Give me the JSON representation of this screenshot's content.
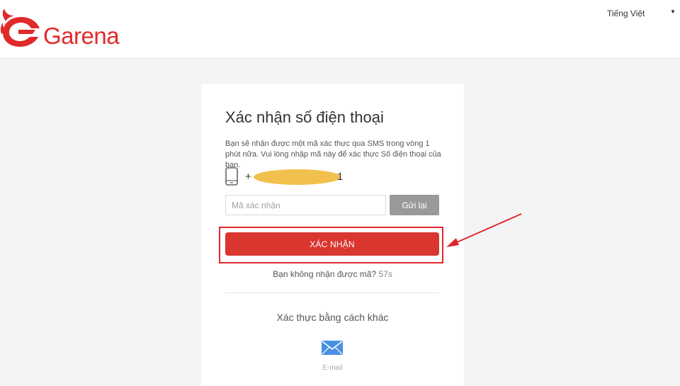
{
  "header": {
    "brand": "Garena",
    "language": "Tiếng Việt",
    "brand_color": "#e02a2a"
  },
  "card": {
    "title": "Xác nhận số điện thoại",
    "description": "Bạn sẽ nhận được một mã xác thực qua SMS trong vòng 1 phút nữa. Vui lòng nhập mã này để xác thực Số điện thoại của bạn.",
    "phone_prefix": "+",
    "phone_suffix": "1",
    "code_placeholder": "Mã xác nhận",
    "resend_label": "Gửi lại",
    "confirm_label": "XÁC NHẬN",
    "no_code_text": "Bạn không nhận được mã?",
    "timer": "57s",
    "alt_title": "Xác thực bằng cách khác",
    "email_label": "E-mail"
  },
  "colors": {
    "confirm_button": "#d9362f",
    "highlight": "#e0262b",
    "resend_button": "#999999",
    "email_icon": "#4a90e2"
  },
  "icons": {
    "phone": "phone-icon",
    "email": "email-icon",
    "caret": "caret-down-icon"
  }
}
